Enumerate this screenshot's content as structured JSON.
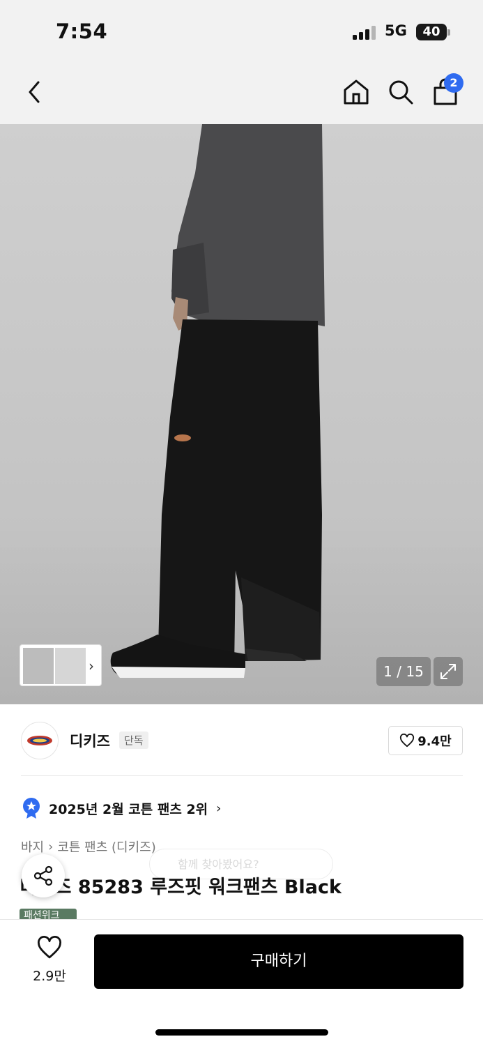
{
  "status_bar": {
    "time": "7:54",
    "network": "5G",
    "battery": "40"
  },
  "nav": {
    "cart_count": "2"
  },
  "gallery": {
    "counter": "1 / 15"
  },
  "brand": {
    "name": "디키즈",
    "tag": "단독",
    "likes": "9.4만"
  },
  "ranking": {
    "text": "2025년 2월 코튼 팬츠 2위"
  },
  "breadcrumb": {
    "category": "바지",
    "subcategory": "코튼 팬츠 (디키즈)"
  },
  "product": {
    "title": "디키즈 85283 루즈핏 워크팬츠 Black",
    "tooltip": "함께 찾아봤어요?",
    "badge": "패션위크"
  },
  "bottom_bar": {
    "wish_count": "2.9만",
    "buy_label": "구매하기"
  },
  "colors": {
    "accent_blue": "#2f6bf0",
    "buy_button": "#000000"
  },
  "icons": [
    "back-icon",
    "home-icon",
    "search-icon",
    "cart-icon",
    "expand-icon",
    "heart-icon",
    "share-icon",
    "star-badge-icon"
  ]
}
